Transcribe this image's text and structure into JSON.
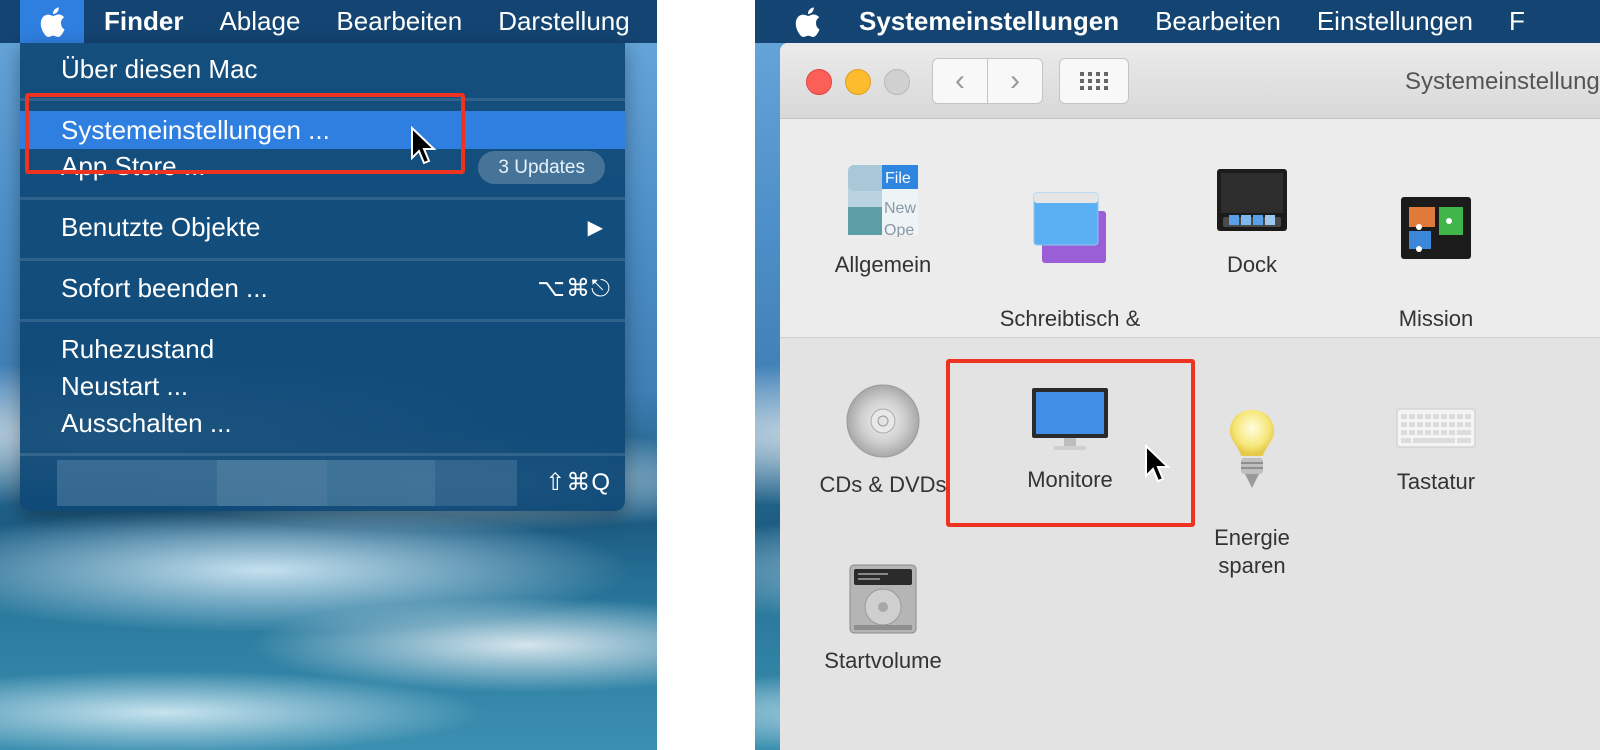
{
  "left": {
    "menubar": {
      "finder": "Finder",
      "items": [
        "Ablage",
        "Bearbeiten",
        "Darstellung"
      ]
    },
    "menu": {
      "about": "Über diesen Mac",
      "system_prefs": "Systemeinstellungen ...",
      "app_store": "App Store ...",
      "updates_badge": "3 Updates",
      "recent_items": "Benutzte Objekte",
      "force_quit": "Sofort beenden ...",
      "force_quit_shortcut": "⌥⌘⎋",
      "sleep": "Ruhezustand",
      "restart": "Neustart ...",
      "shutdown": "Ausschalten ...",
      "logout_shortcut": "⇧⌘Q"
    }
  },
  "right": {
    "menubar": {
      "app": "Systemeinstellungen",
      "items": [
        "Bearbeiten",
        "Einstellungen",
        "F"
      ]
    },
    "window": {
      "title": "Systemeinstellungen",
      "general_icon_text": {
        "file": "File",
        "new": "New",
        "open": "Ope"
      },
      "prefs_row1": [
        {
          "label": "Allgemein"
        },
        {
          "label": "Schreibtisch &\nBildschirmschoner"
        },
        {
          "label": "Dock"
        },
        {
          "label": "Mission\nControl"
        }
      ],
      "prefs_row2": [
        {
          "label": "CDs & DVDs"
        },
        {
          "label": "Monitore"
        },
        {
          "label": "Energie\nsparen"
        },
        {
          "label": "Tastatur"
        }
      ],
      "prefs_row3": [
        {
          "label": "Startvolume"
        }
      ]
    }
  },
  "colors": {
    "highlight": "#2f7fe0",
    "annotation": "#ee3320"
  }
}
